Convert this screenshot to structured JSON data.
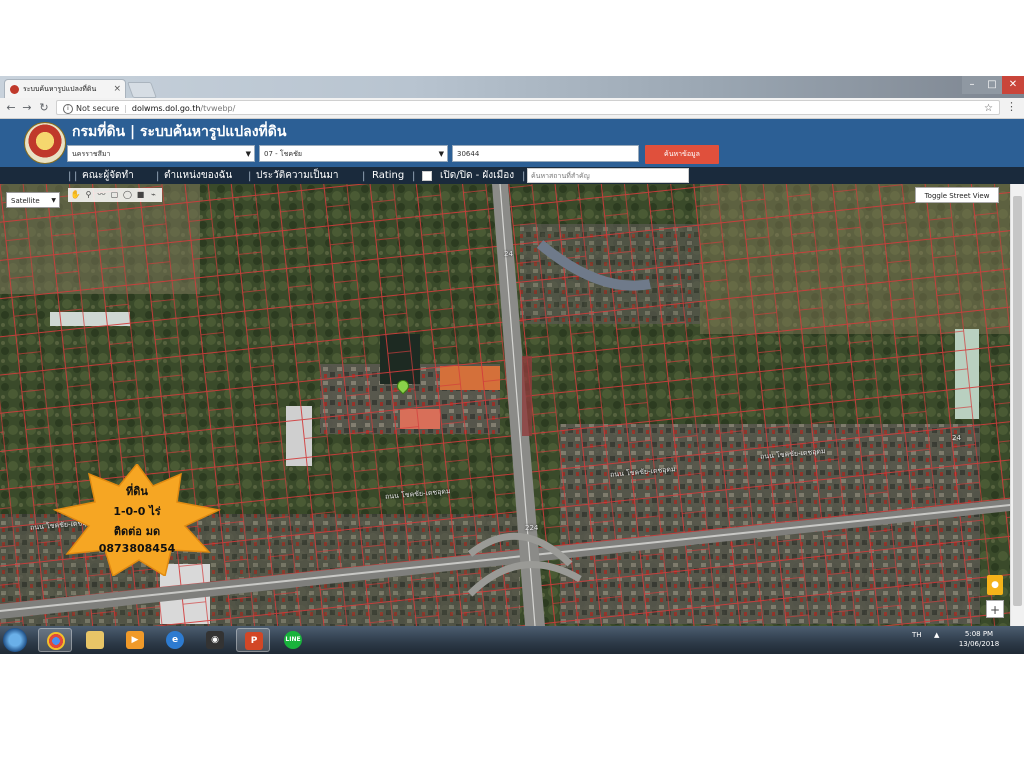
{
  "browser": {
    "tab_title": "ระบบค้นหารูปแปลงที่ดิน",
    "tab_close": "×",
    "security": "Not secure",
    "url_host": "dolwms.dol.go.th",
    "url_path": "/tvwebp/",
    "nav": {
      "back": "←",
      "forward": "→",
      "reload": "↻"
    },
    "star": "☆",
    "menu": "⋮",
    "window_controls": {
      "minimize": "–",
      "maximize": "□",
      "close": "✕"
    }
  },
  "site": {
    "title": "กรมที่ดิน | ระบบค้นหารูปแปลงที่ดิน",
    "province_select": "นครราชสีมา",
    "district_select": "07 - โชคชัย",
    "parcel_input": "30644",
    "search_button": "ค้นหาข้อมูล"
  },
  "navbar": {
    "items": [
      "คณะผู้จัดทำ",
      "ตำแหน่งของฉัน",
      "ประวัติความเป็นมา",
      "Rating",
      "เปิด/ปิด - ผังเมือง"
    ],
    "separator": "|",
    "place_placeholder": "ค้นหาสถานที่สำคัญ"
  },
  "map": {
    "layer_select": "Satellite",
    "toggle_street_view": "Toggle Street View",
    "zoom_in": "+",
    "road_labels": [
      "ถนน โชคชัย-เดชอุดม",
      "ถนน โชคชัย-เดชอุดม",
      "ถนน โชคชัย-เดชอุดม",
      "ถนน โชคชัย-เดชอุดม"
    ],
    "route_shields": [
      "24",
      "224",
      "24"
    ]
  },
  "overlay_badge": {
    "lines": [
      "ที่ดิน",
      "1-0-0 ไร่",
      "ติดต่อ มด",
      "0873808454"
    ],
    "color": "#f6a623"
  },
  "taskbar": {
    "apps": [
      "chrome",
      "explorer",
      "media-player",
      "internet-explorer",
      "camera",
      "powerpoint",
      "line"
    ],
    "language": "TH",
    "time": "5:08 PM",
    "date": "13/06/2018"
  },
  "colors": {
    "header": "#2c5f95",
    "nav_strip": "#1a2a3c",
    "search_button": "#e0503c",
    "parcel_lines": "#d23b3b"
  }
}
